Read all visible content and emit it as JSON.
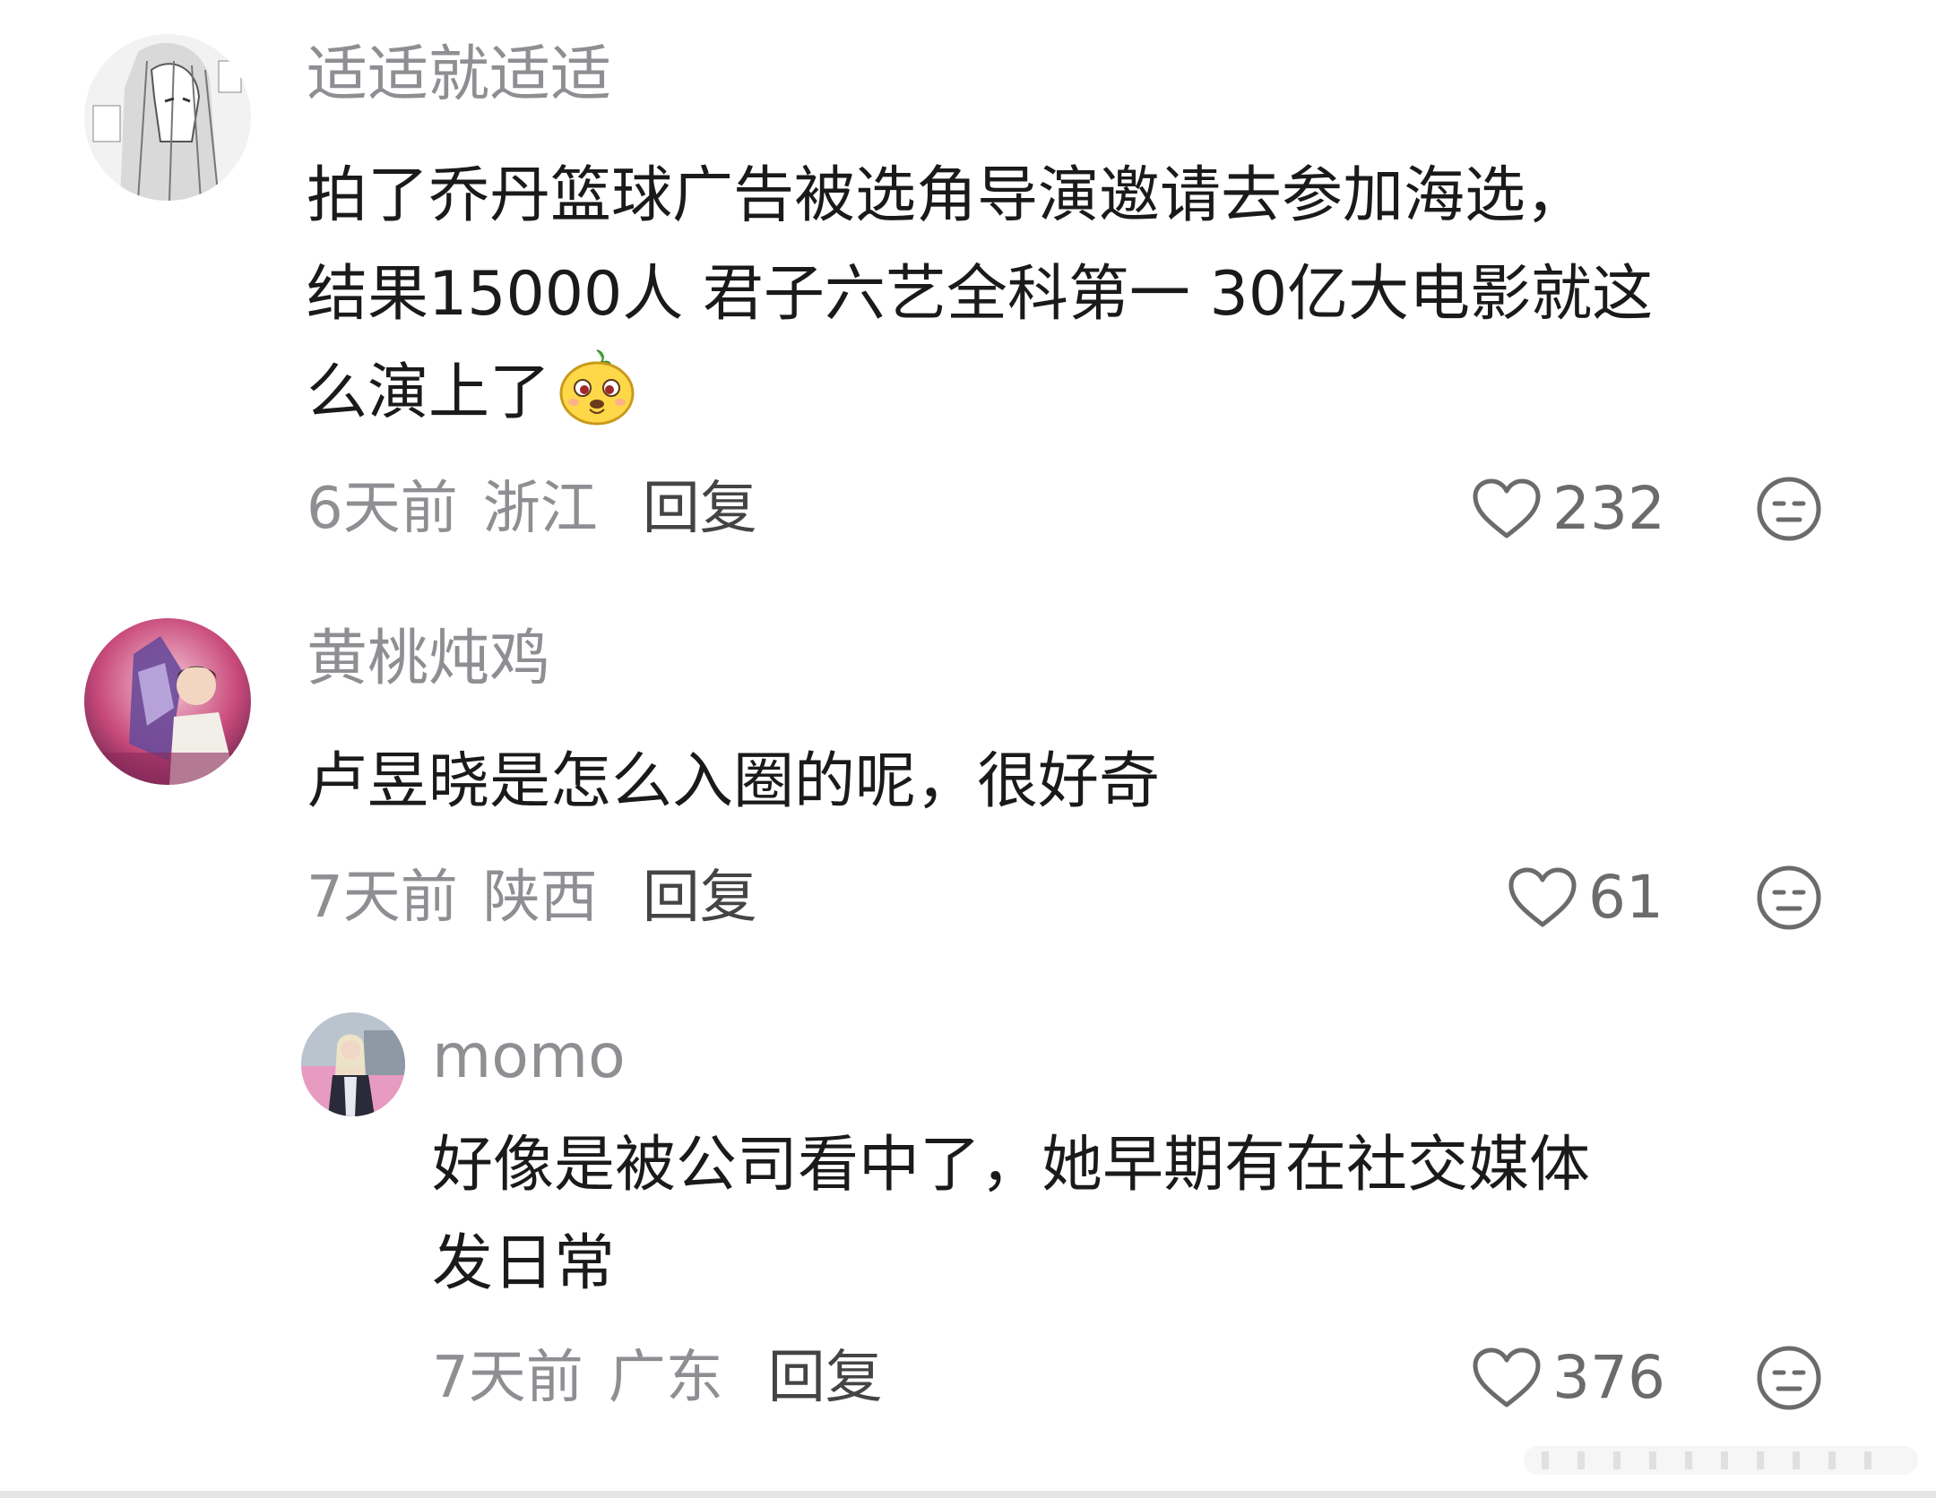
{
  "comments": [
    {
      "username": "适适就适适",
      "text_lines": [
        "拍了乔丹篮球广告被选角导演邀请去参加海选，",
        "结果15000人 君子六艺全科第一 30亿大电影就这",
        "么演上了"
      ],
      "time": "6天前",
      "location": "浙江",
      "reply_label": "回复",
      "likes": "232"
    },
    {
      "username": "黄桃炖鸡",
      "text_lines": [
        "卢昱晓是怎么入圈的呢，很好奇"
      ],
      "time": "7天前",
      "location": "陕西",
      "reply_label": "回复",
      "likes": "61"
    },
    {
      "username": "momo",
      "text_lines": [
        "好像是被公司看中了，她早期有在社交媒体",
        "发日常"
      ],
      "time": "7天前",
      "location": "广东",
      "reply_label": "回复",
      "likes": "376"
    }
  ],
  "colors": {
    "username": "#8e8e93",
    "body": "#1a1a1a",
    "reply": "#444444",
    "meta": "#8e8e93"
  },
  "icons": {
    "like": "heart-outline-icon",
    "dislike": "meh-face-icon",
    "emoji": "yellow-mascot-emoji"
  }
}
